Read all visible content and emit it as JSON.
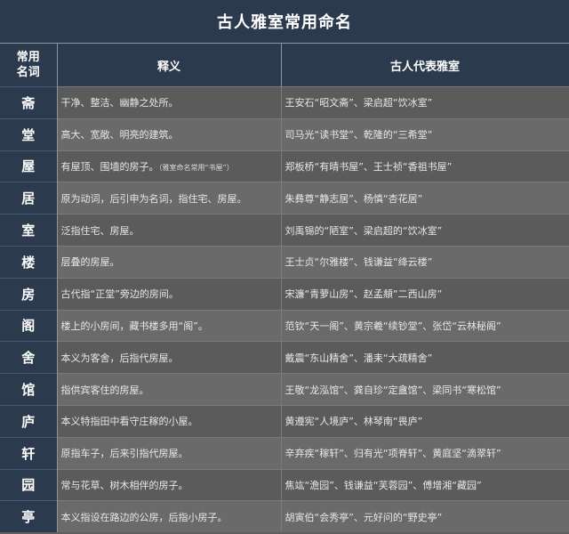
{
  "title": "古人雅室常用命名",
  "headers": {
    "name_line1": "常用",
    "name_line2": "名词",
    "meaning": "释义",
    "examples": "古人代表雅室"
  },
  "rows": [
    {
      "name": "斋",
      "meaning": "干净、整洁、幽静之处所。",
      "note": "",
      "examples": "王安石“昭文斋”、梁启超“饮冰室”"
    },
    {
      "name": "堂",
      "meaning": "高大、宽敞、明亮的建筑。",
      "note": "",
      "examples": "司马光“读书堂”、乾隆的“三希堂”"
    },
    {
      "name": "屋",
      "meaning": "有屋顶、围墙的房子。",
      "note": "（雅室命名常用“书屋”）",
      "examples": "郑板桥“有晴书屋”、王士祯“香祖书屋”"
    },
    {
      "name": "居",
      "meaning": "原为动词，后引申为名词，指住宅、房屋。",
      "note": "",
      "examples": "朱彝尊“静志居”、杨慎“杏花居”"
    },
    {
      "name": "室",
      "meaning": "泛指住宅、房屋。",
      "note": "",
      "examples": "刘禹锡的“陋室”、梁启超的“饮冰室”"
    },
    {
      "name": "楼",
      "meaning": "层叠的房屋。",
      "note": "",
      "examples": "王士贞“尔雅楼”、钱谦益“绛云楼”"
    },
    {
      "name": "房",
      "meaning": "古代指“正堂”旁边的房间。",
      "note": "",
      "examples": "宋濂“青萝山房”、赵孟頫“二西山房”"
    },
    {
      "name": "阁",
      "meaning": "楼上的小房间，藏书楼多用“阁”。",
      "note": "",
      "examples": "范钦“天一阁”、黄宗羲“续钞堂”、张岱“云林秘阁”"
    },
    {
      "name": "舍",
      "meaning": "本义为客舍，后指代房屋。",
      "note": "",
      "examples": "戴震“东山精舍”、潘耒“大疏精舍”"
    },
    {
      "name": "馆",
      "meaning": "指供宾客住的房屋。",
      "note": "",
      "examples": "王敬“龙泓馆”、龚自珍“定盦馆”、梁同书“寒松馆”"
    },
    {
      "name": "庐",
      "meaning": "本义特指田中看守庄稼的小屋。",
      "note": "",
      "examples": "黄遵宪“人境庐”、林琴南“畏庐”"
    },
    {
      "name": "轩",
      "meaning": "原指车子，后来引指代房屋。",
      "note": "",
      "examples": "辛弃疾“稼轩”、归有光“项脊轩”、黄庭坚“滴翠轩”"
    },
    {
      "name": "园",
      "meaning": "常与花草、树木相伴的房子。",
      "note": "",
      "examples": "焦竑“澹园”、钱谦益“芙蓉园”、傅增湘“藏园”"
    },
    {
      "name": "亭",
      "meaning": "本义指设在路边的公房，后指小房子。",
      "note": "",
      "examples": "胡寅伯“会秀亭”、元好问的“野史亭”"
    }
  ]
}
